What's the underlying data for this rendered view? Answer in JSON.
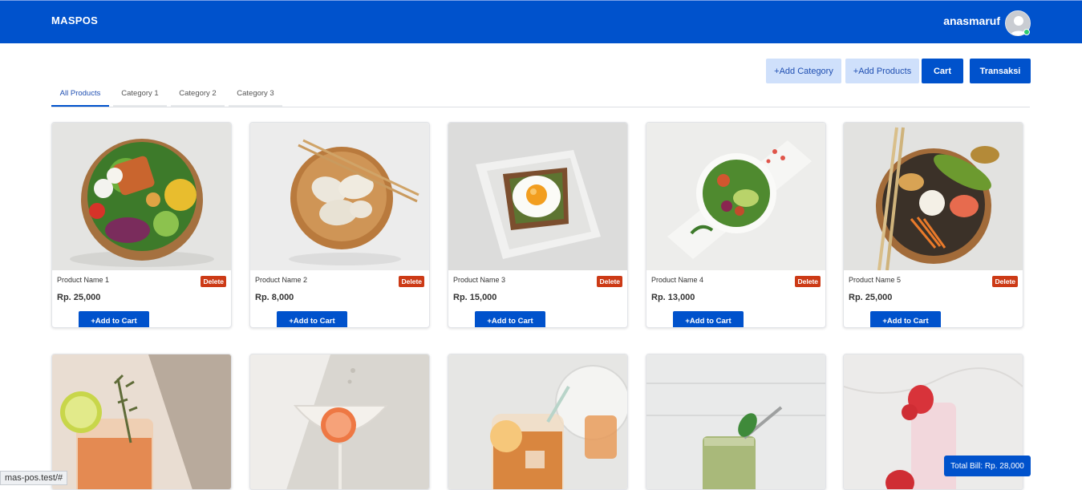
{
  "navbar": {
    "brand": "MASPOS",
    "username": "anasmaruf",
    "accent": "#0052cc"
  },
  "actions": {
    "add_category": "+Add Category",
    "add_products": "+Add Products",
    "cart": "Cart",
    "transaksi": "Transaksi"
  },
  "tabs": [
    {
      "label": "All Products",
      "active": true
    },
    {
      "label": "Category 1",
      "active": false
    },
    {
      "label": "Category 2",
      "active": false
    },
    {
      "label": "Category 3",
      "active": false
    }
  ],
  "products": [
    {
      "name": "Product Name 1",
      "price": "Rp. 25,000",
      "delete_label": "Delete",
      "add_label": "+Add to Cart",
      "image": "salad-bowl"
    },
    {
      "name": "Product Name 2",
      "price": "Rp. 8,000",
      "delete_label": "Delete",
      "add_label": "+Add to Cart",
      "image": "dumplings"
    },
    {
      "name": "Product Name 3",
      "price": "Rp. 15,000",
      "delete_label": "Delete",
      "add_label": "+Add to Cart",
      "image": "egg-toast"
    },
    {
      "name": "Product Name 4",
      "price": "Rp. 13,000",
      "delete_label": "Delete",
      "add_label": "+Add to Cart",
      "image": "green-salad"
    },
    {
      "name": "Product Name 5",
      "price": "Rp. 25,000",
      "delete_label": "Delete",
      "add_label": "+Add to Cart",
      "image": "poke-bowl"
    }
  ],
  "drinks": [
    {
      "image": "orange-cocktail"
    },
    {
      "image": "grapefruit-martini"
    },
    {
      "image": "iced-tea"
    },
    {
      "image": "green-smoothie"
    },
    {
      "image": "strawberry-milkshake"
    }
  ],
  "total_bill": "Total Bill: Rp. 28,000",
  "status_url": "mas-pos.test/#"
}
